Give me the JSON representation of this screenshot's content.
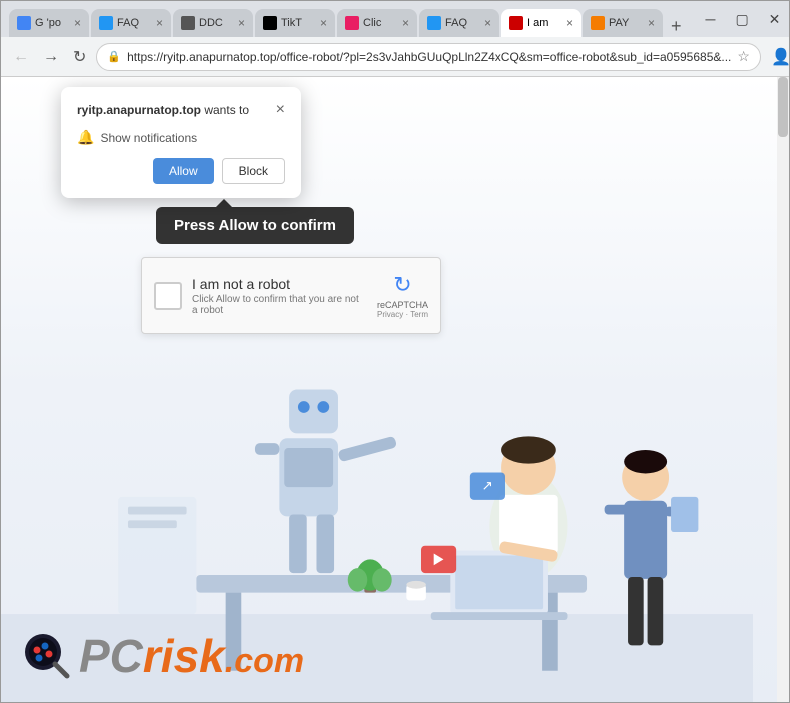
{
  "browser": {
    "tabs": [
      {
        "id": "tab-g",
        "label": "G 'po",
        "favicon_color": "#4285f4",
        "active": false
      },
      {
        "id": "tab-faq",
        "label": "FAQ",
        "favicon_color": "#2196f3",
        "active": false
      },
      {
        "id": "tab-ddc",
        "label": "DDC",
        "favicon_color": "#2196f3",
        "active": false
      },
      {
        "id": "tab-tikt",
        "label": "TikT",
        "favicon_color": "#000",
        "active": false
      },
      {
        "id": "tab-click",
        "label": "Clic",
        "favicon_color": "#e91e63",
        "active": false
      },
      {
        "id": "tab-faq2",
        "label": "FAQ",
        "favicon_color": "#2196f3",
        "active": false
      },
      {
        "id": "tab-iam",
        "label": "I am",
        "favicon_color": "#c00",
        "active": true
      },
      {
        "id": "tab-pay",
        "label": "PAY",
        "favicon_color": "#f57c00",
        "active": false
      }
    ],
    "url": "https://ryitp.anapurnatop.top/office-robot/?pl=2s3vJahbGUuQpLln2Z4xCQ&sm=office-robot&sub_id=a0595685&..."
  },
  "popup": {
    "site_name": "ryitp.anapurnatop.top",
    "wants_to": "wants to",
    "notification_label": "Show notifications",
    "allow_label": "Allow",
    "block_label": "Block",
    "close_symbol": "×"
  },
  "callout": {
    "text": "Press Allow to confirm"
  },
  "recaptcha": {
    "title": "I am not a robot",
    "subtitle": "Click Allow to confirm that you are not a robot",
    "label": "reCAPTCHA",
    "privacy": "Privacy",
    "separator": " · ",
    "terms": "Term"
  },
  "logo": {
    "pc": "PC",
    "risk": "risk",
    "com": ".com"
  }
}
